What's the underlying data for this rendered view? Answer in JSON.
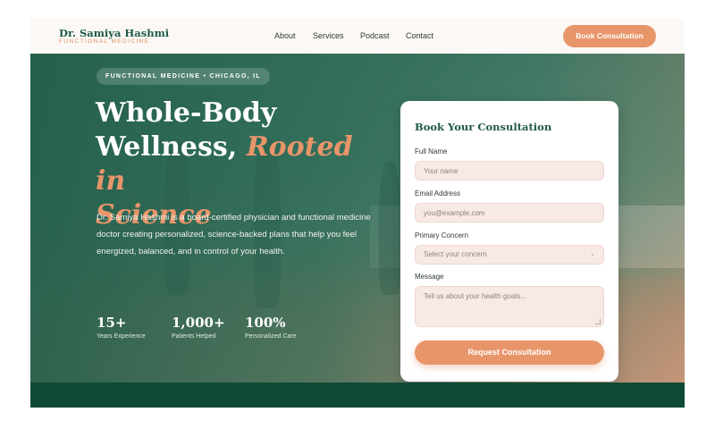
{
  "header": {
    "brand_name": "Dr. Samiya Hashmi",
    "brand_sub": "FUNCTIONAL MEDICINE",
    "nav": [
      "About",
      "Services",
      "Podcast",
      "Contact"
    ],
    "cta": "Book Consultation"
  },
  "hero": {
    "tag": "FUNCTIONAL MEDICINE • CHICAGO, IL",
    "headline_1": "Whole-Body",
    "headline_2": "Wellness,",
    "headline_accent_1": "Rooted in",
    "headline_accent_2": "Science",
    "intro": "Dr. Samiya Hashmi is a board-certified physician and functional medicine doctor creating personalized, science-backed plans that help you feel energized, balanced, and in control of your health.",
    "stats": [
      {
        "value": "15+",
        "label": "Years Experience"
      },
      {
        "value": "1,000+",
        "label": "Patients Helped"
      },
      {
        "value": "100%",
        "label": "Personalized Care"
      }
    ]
  },
  "form": {
    "title": "Book Your Consultation",
    "name_label": "Full Name",
    "name_placeholder": "Your name",
    "email_label": "Email Address",
    "email_placeholder": "you@example.com",
    "concern_label": "Primary Concern",
    "concern_value": "Select your concern",
    "message_label": "Message",
    "message_placeholder": "Tell us about your health goals...",
    "submit": "Request Consultation"
  },
  "colors": {
    "brand_green": "#1f5a47",
    "accent_orange": "#e8956a",
    "footer_green": "#0f4a36"
  }
}
